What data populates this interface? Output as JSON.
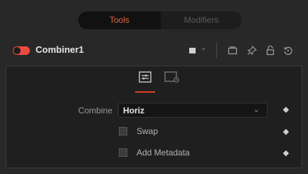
{
  "tabs": [
    {
      "label": "Tools",
      "active": true
    },
    {
      "label": "Modifiers",
      "active": false
    }
  ],
  "node": {
    "name": "Combiner1",
    "enabled": true,
    "color_swatch": "#cfcfcf"
  },
  "header_icons": [
    "color-swatch-icon",
    "chevron-down-icon",
    "view-icon",
    "pin-icon",
    "lock-icon",
    "reset-icon"
  ],
  "control_tabs": [
    {
      "icon": "controls-icon",
      "active": true
    },
    {
      "icon": "settings-icon",
      "active": false
    }
  ],
  "controls": {
    "combine": {
      "label": "Combine",
      "value": "Horiz"
    },
    "swap": {
      "label": "Swap",
      "checked": false
    },
    "add_metadata": {
      "label": "Add Metadata",
      "checked": false
    }
  },
  "colors": {
    "accent_red": "#f04a3e",
    "tab_active_text": "#e06a3d",
    "underline": "#e03c2c"
  }
}
